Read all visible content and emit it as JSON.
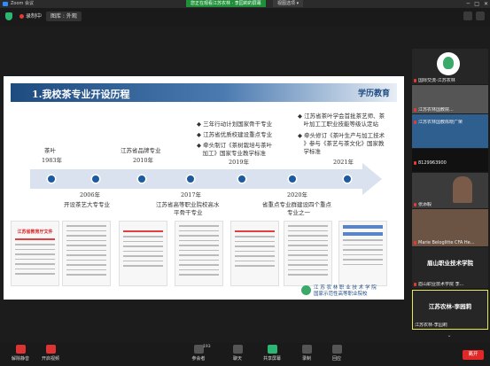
{
  "titlebar": {
    "app": "Zoom 会议",
    "share_banner": "您正在观看江苏农林 · 李园莉的屏幕",
    "view_options": "视图选项 ▾"
  },
  "topbar": {
    "recording": "录制中",
    "view_mode": "图库 : 外观"
  },
  "slide": {
    "title": "1.我校茶专业开设历程",
    "tag": "学历教育",
    "top_items": [
      {
        "label": "茶叶",
        "year": "1983年"
      },
      {
        "label": "江苏省品牌专业",
        "year": "2010年"
      },
      {
        "lines": [
          "◆ 三年行动计划国家骨干专业",
          "◆ 江苏省优质校建设重点专业",
          "◆ 牵头制订《茶树栽培与茶叶",
          "　加工》国家专业教学标准"
        ],
        "year": "2019年"
      },
      {
        "lines": [
          "◆ 江苏省茶叶学会首批茶艺师、茶",
          "　叶加工工职业技能等级认定站",
          "◆ 牵头修订《茶叶生产与加工技术",
          "　》参与《茶艺与茶文化》国家教",
          "　学标准"
        ],
        "year": "2021年"
      }
    ],
    "bottom_items": [
      {
        "year": "2006年",
        "label": "开设茶艺大专专业"
      },
      {
        "year": "2017年",
        "lines": [
          "江苏省高等职业院校高水",
          "平骨干专业"
        ]
      },
      {
        "year": "2020年",
        "lines": [
          "省重点专业群建设四个重点",
          "专业之一"
        ]
      }
    ],
    "doc_title": "江苏省教育厅文件",
    "footer": [
      "江 苏 农 林 职 业 技 术 学 院",
      "国家示范性高等职业院校"
    ]
  },
  "sidebar": {
    "tiles": [
      {
        "name": "国际交流-江苏农林",
        "big": ""
      },
      {
        "name": "江苏农林国教院...",
        "big": ""
      },
      {
        "name": "江苏农林国教陈晓广荣",
        "big": ""
      },
      {
        "name": "8129963900",
        "big": ""
      },
      {
        "name": "张添毅",
        "big": ""
      },
      {
        "name": "Marie Beloglitte CFA He...",
        "big": ""
      },
      {
        "name": "眉山职业技术学院 李...",
        "big": "眉山职业技术学院"
      },
      {
        "name": "江苏农林-李园莉",
        "big": "江苏农林-李园莉"
      }
    ]
  },
  "toolbar": {
    "mute": "解除静音",
    "video": "开启视频",
    "participants": "参会者",
    "participants_count": "193",
    "chat": "聊天",
    "share": "共享屏幕",
    "record": "录制",
    "reactions": "回应",
    "leave": "离开"
  },
  "colors": {
    "accent": "#1e4b80",
    "share_green": "#2bb673",
    "leave_red": "#e02828",
    "active_border": "#e8e850"
  }
}
